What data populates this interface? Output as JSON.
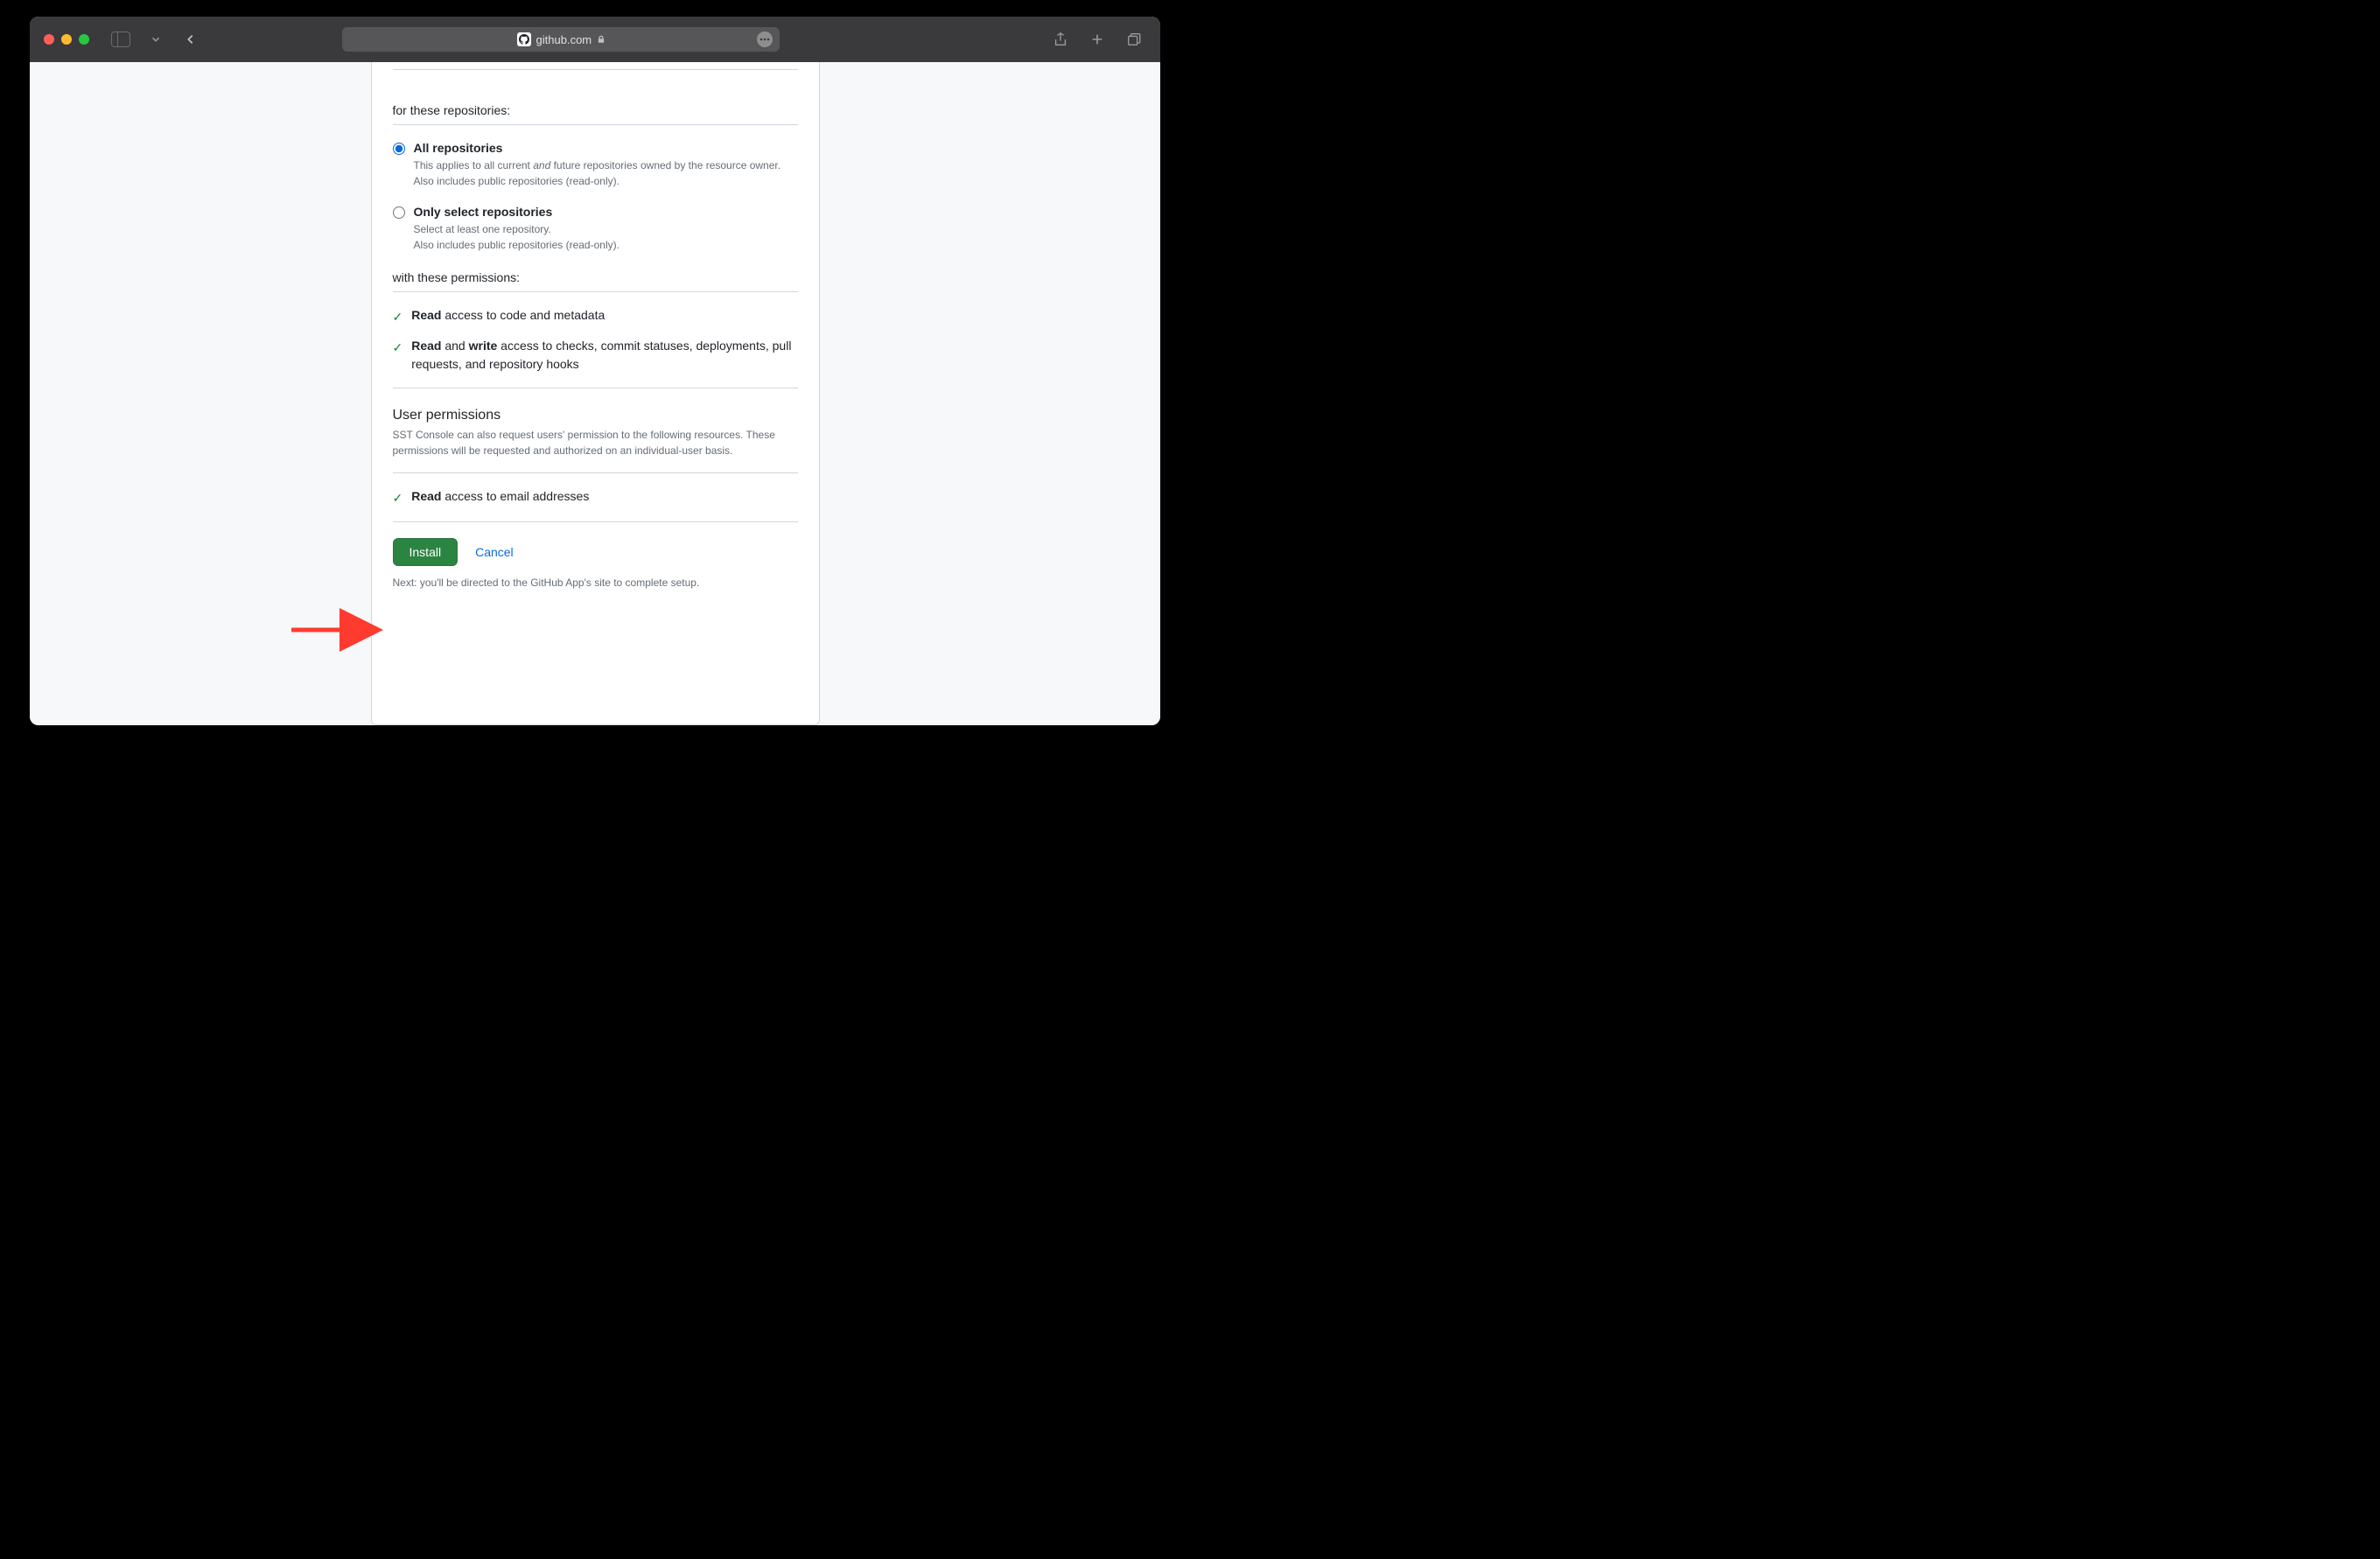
{
  "browser": {
    "url": "github.com"
  },
  "page": {
    "repos_heading": "for these repositories:",
    "radio_all": {
      "title": "All repositories",
      "desc_pre": "This applies to all current ",
      "desc_em": "and",
      "desc_post": " future repositories owned by the resource owner.",
      "desc_line2": "Also includes public repositories (read-only)."
    },
    "radio_select": {
      "title": "Only select repositories",
      "desc_line1": "Select at least one repository.",
      "desc_line2": "Also includes public repositories (read-only)."
    },
    "perms_heading": "with these permissions:",
    "perm1_bold": "Read",
    "perm1_rest": " access to code and metadata",
    "perm2_bold1": "Read",
    "perm2_mid": " and ",
    "perm2_bold2": "write",
    "perm2_rest": " access to checks, commit statuses, deployments, pull requests, and repository hooks",
    "user_perm_heading": "User permissions",
    "user_perm_desc": "SST Console can also request users' permission to the following resources. These permissions will be requested and authorized on an individual-user basis.",
    "perm3_bold": "Read",
    "perm3_rest": " access to email addresses",
    "install_label": "Install",
    "cancel_label": "Cancel",
    "next_text": "Next: you'll be directed to the GitHub App's site to complete setup."
  }
}
